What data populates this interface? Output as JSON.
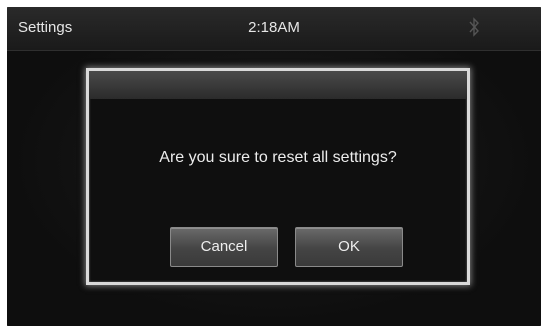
{
  "statusbar": {
    "title": "Settings",
    "clock": "2:18AM",
    "bluetooth_icon": "bluetooth-icon"
  },
  "dialog": {
    "message": "Are you sure to reset all settings?",
    "cancel_label": "Cancel",
    "ok_label": "OK"
  },
  "colors": {
    "screen_bg": "#121212",
    "dialog_border": "#d9d9d9",
    "button_face": "#4a4a4a"
  }
}
